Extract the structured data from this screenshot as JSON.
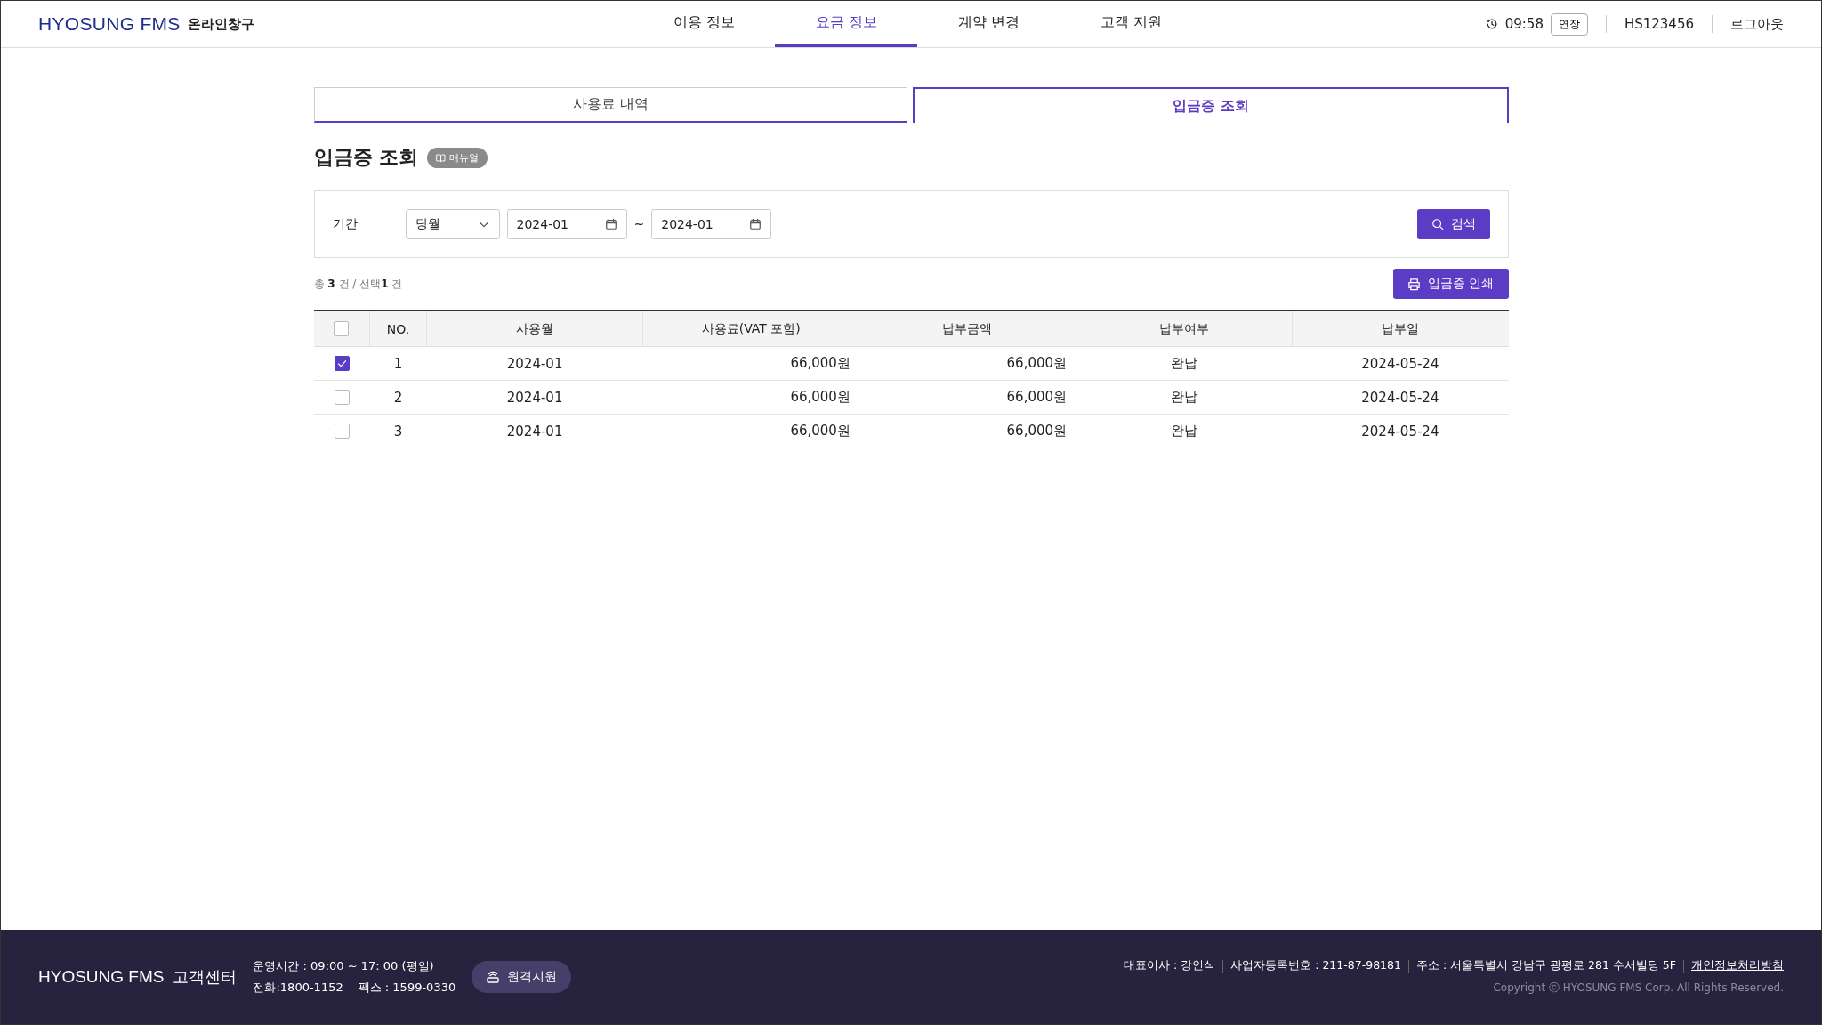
{
  "header": {
    "logo": "HYOSUNG FMS",
    "service_name": "온라인창구",
    "nav": [
      {
        "label": "이용 정보",
        "selected": false
      },
      {
        "label": "요금 정보",
        "selected": true
      },
      {
        "label": "계약 변경",
        "selected": false
      },
      {
        "label": "고객 지원",
        "selected": false
      }
    ],
    "session_time": "09:58",
    "extend_button": "연장",
    "user_id": "HS123456",
    "logout": "로그아웃"
  },
  "tabs": [
    {
      "label": "사용료 내역",
      "selected": false
    },
    {
      "label": "입금증 조회",
      "selected": true
    }
  ],
  "page_title": "입금증 조회",
  "manual_button": "매뉴얼",
  "filter": {
    "label": "기간",
    "period": "당월",
    "date_from": "2024-01",
    "separator": "~",
    "date_to": "2024-01",
    "search_button": "검색"
  },
  "summary": "총 **3** 건 / 선택**1** 건",
  "print_button": "입금증 인쇄",
  "table": {
    "all_selected": false,
    "columns": [
      {
        "label": "NO.",
        "kind": "text"
      },
      {
        "label": "사용월",
        "kind": "text"
      },
      {
        "label": "사용료(VAT 포함)",
        "kind": "amount"
      },
      {
        "label": "납부금액",
        "kind": "amount"
      },
      {
        "label": "납부여부",
        "kind": "text"
      },
      {
        "label": "납부일",
        "kind": "text"
      }
    ],
    "rows": [
      {
        "selected": true,
        "cells": [
          "1",
          "2024-01",
          "66,000원",
          "66,000원",
          "완납",
          "2024-05-24"
        ]
      },
      {
        "selected": false,
        "cells": [
          "2",
          "2024-01",
          "66,000원",
          "66,000원",
          "완납",
          "2024-05-24"
        ]
      },
      {
        "selected": false,
        "cells": [
          "3",
          "2024-01",
          "66,000원",
          "66,000원",
          "완납",
          "2024-05-24"
        ]
      }
    ]
  },
  "footer": {
    "logo": "HYOSUNG FMS",
    "center_name": "고객센터",
    "hours": "운영시간 : 09:00 ~ 17: 00 (평일)",
    "phone": "전화:1800-1152",
    "fax": "팩스 : 1599-0330",
    "remote_button": "원격지원",
    "company_info": [
      "대표이사 : 강인식",
      "사업자등록번호 : 211-87-98181",
      "주소 : 서울특별시 강남구 광평로 281 수서빌딩 5F"
    ],
    "privacy_link": "개인정보처리방침",
    "copyright": "Copyright ⓒ HYOSUNG FMS Corp. All Rights Reserved."
  }
}
